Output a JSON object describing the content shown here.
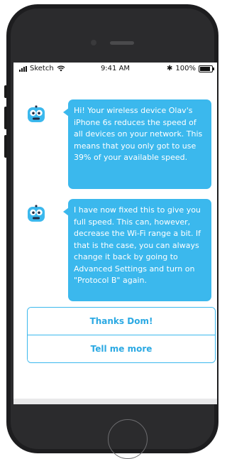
{
  "status_bar": {
    "carrier": "Sketch",
    "time": "9:41 AM",
    "bluetooth": "✱",
    "battery_percent": "100%",
    "battery_level": 1.0
  },
  "messages": [
    {
      "sender_avatar": "robot-avatar-icon",
      "text": "Hi! Your wireless device Olav's iPhone 6s reduces the speed of all devices on your network. This means that you only got to use 39% of your available speed."
    },
    {
      "sender_avatar": "robot-avatar-icon",
      "text": "I have now fixed this to give you full speed. This can, however, decrease the Wi-Fi range a bit. If that is the case, you can always change it back by going to Advanced Settings and turn on \"Protocol B\" again."
    }
  ],
  "quick_replies": [
    {
      "label": "Thanks Dom!"
    },
    {
      "label": "Tell me more"
    }
  ],
  "colors": {
    "accent": "#3bb8ed",
    "reply_text": "#2ba9e3",
    "phone_body": "#1d1d1f"
  }
}
